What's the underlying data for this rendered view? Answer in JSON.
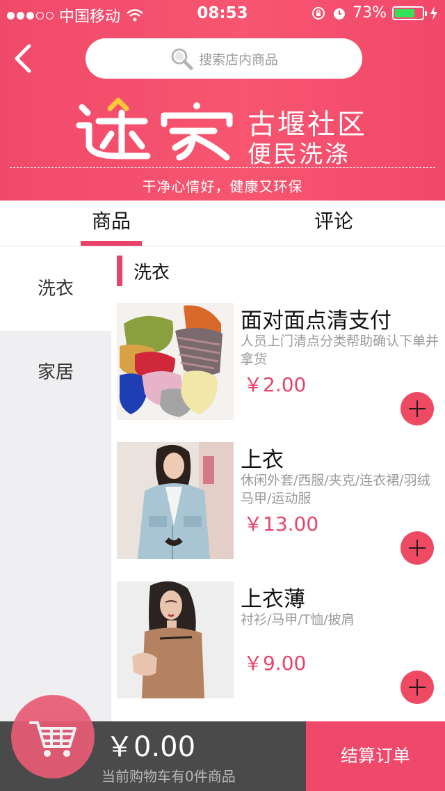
{
  "status_bar": {
    "carrier": "中国移动",
    "time": "08:53",
    "battery": "73%",
    "battery_level": 0.73,
    "signal_dots_filled": 3,
    "signal_dots_total": 5
  },
  "header": {
    "search_placeholder": "搜索店内商品",
    "logo_text": "迷家",
    "brand_line1": "古堰社区",
    "brand_line2": "便民洗涤",
    "slogan": "干净心情好，健康又环保"
  },
  "tabs": [
    {
      "label": "商品",
      "active": true
    },
    {
      "label": "评论",
      "active": false
    }
  ],
  "categories": [
    {
      "label": "洗衣",
      "active": true
    },
    {
      "label": "家居",
      "active": false
    }
  ],
  "section_title": "洗衣",
  "products": [
    {
      "name": "面对面点清支付",
      "desc": "人员上门清点分类帮助确认下单并拿货",
      "price": "￥2.00"
    },
    {
      "name": "上衣",
      "desc": "休闲外套/西服/夹克/连衣裙/羽绒马甲/运动服",
      "price": "￥13.00"
    },
    {
      "name": "上衣薄",
      "desc": "衬衫/马甲/T恤/披肩",
      "price": "￥9.00"
    }
  ],
  "cart": {
    "total": "￥0.00",
    "info": "当前购物车有0件商品",
    "checkout_label": "结算订单"
  },
  "colors": {
    "accent": "#f04a6a",
    "price": "#e8436a",
    "sidebar_bg": "#efeff2",
    "cart_bar": "#4a4a4a"
  }
}
